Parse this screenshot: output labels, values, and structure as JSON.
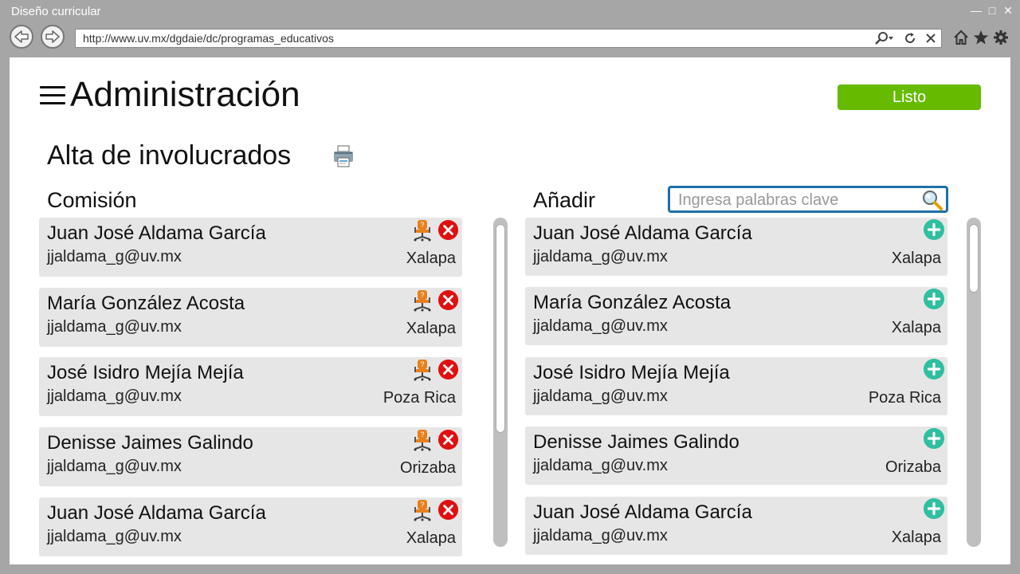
{
  "window": {
    "title": "Diseño curricular"
  },
  "browser": {
    "url": "http://www.uv.mx/dgdaie/dc/programas_educativos"
  },
  "header": {
    "title": "Administración",
    "done_label": "Listo"
  },
  "section": {
    "title": "Alta de involucrados"
  },
  "comision": {
    "heading": "Comisión",
    "items": [
      {
        "name": "Juan José Aldama García",
        "email": "jjaldama_g@uv.mx",
        "city": "Xalapa"
      },
      {
        "name": "María González Acosta",
        "email": "jjaldama_g@uv.mx",
        "city": "Xalapa"
      },
      {
        "name": "José Isidro Mejía Mejía",
        "email": "jjaldama_g@uv.mx",
        "city": "Poza Rica"
      },
      {
        "name": "Denisse Jaimes Galindo",
        "email": "jjaldama_g@uv.mx",
        "city": "Orizaba"
      },
      {
        "name": "Juan José Aldama García",
        "email": "jjaldama_g@uv.mx",
        "city": "Xalapa"
      }
    ]
  },
  "anadir": {
    "heading": "Añadir",
    "search_placeholder": "Ingresa palabras clave",
    "items": [
      {
        "name": "Juan José Aldama García",
        "email": "jjaldama_g@uv.mx",
        "city": "Xalapa"
      },
      {
        "name": "María González Acosta",
        "email": "jjaldama_g@uv.mx",
        "city": "Xalapa"
      },
      {
        "name": "José Isidro Mejía Mejía",
        "email": "jjaldama_g@uv.mx",
        "city": "Poza Rica"
      },
      {
        "name": "Denisse Jaimes Galindo",
        "email": "jjaldama_g@uv.mx",
        "city": "Orizaba"
      },
      {
        "name": "Juan José Aldama García",
        "email": "jjaldama_g@uv.mx",
        "city": "Xalapa"
      }
    ]
  },
  "colors": {
    "accent_green": "#66bb00",
    "remove_red": "#e01010",
    "add_teal": "#2fbfa0",
    "search_border": "#1f6fa8",
    "card_bg": "#e7e6e6"
  },
  "icons": {
    "menu": "hamburger-icon",
    "print": "printer-icon",
    "search": "magnifier-icon",
    "role": "office-chair-icon",
    "remove": "close-circle-icon",
    "add": "plus-circle-icon"
  }
}
